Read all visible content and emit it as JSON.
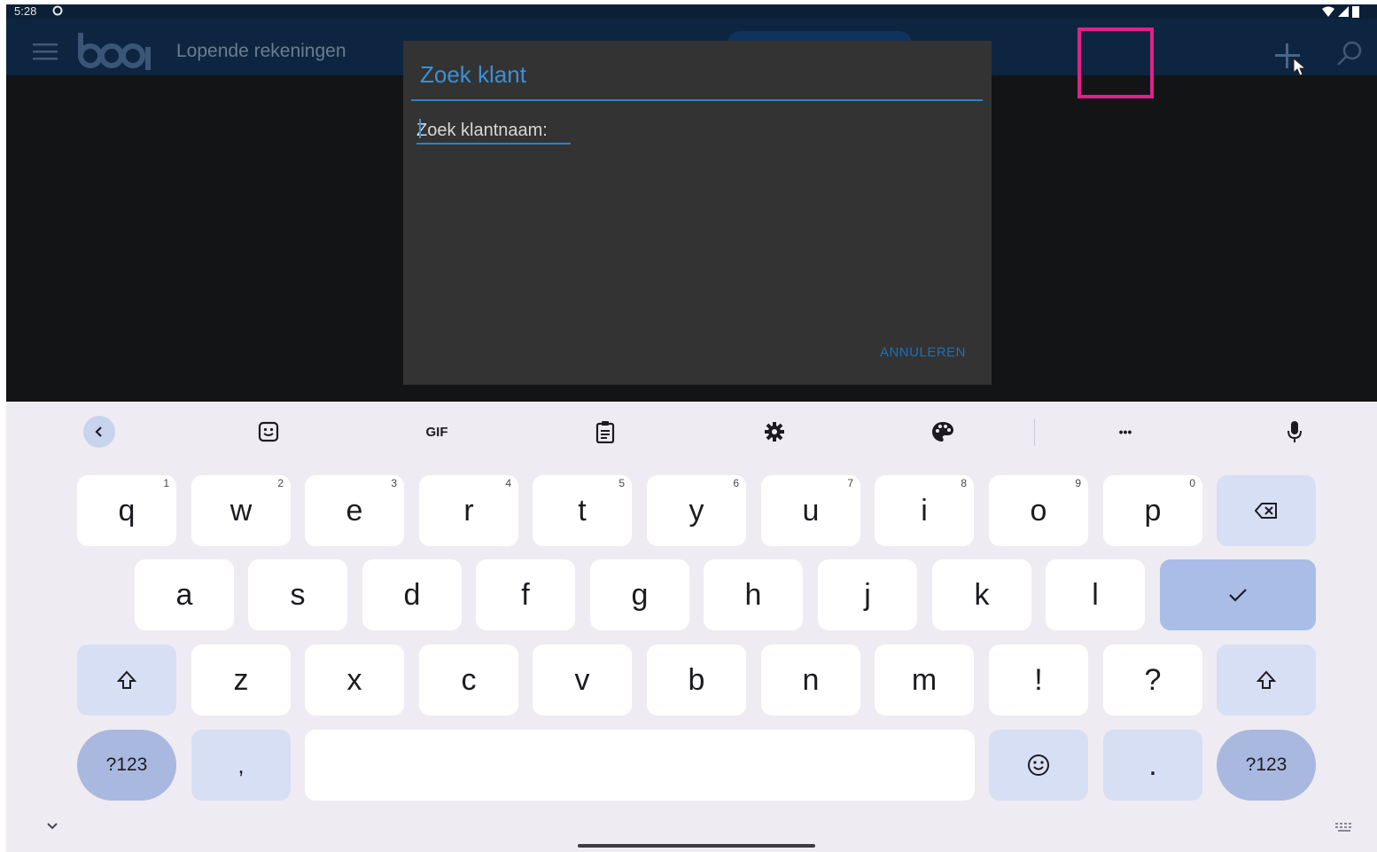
{
  "status_bar": {
    "time": "5:28"
  },
  "app_bar": {
    "brand": "booq",
    "title": "Lopende rekeningen"
  },
  "dialog": {
    "title": "Zoek klant",
    "search_label": "Zoek klantnaam:",
    "cancel_label": "ANNULEREN"
  },
  "keyboard": {
    "toolbar": {
      "gif_label": "GIF",
      "more_label": "•••"
    },
    "row1": [
      {
        "label": "q",
        "hint": "1"
      },
      {
        "label": "w",
        "hint": "2"
      },
      {
        "label": "e",
        "hint": "3"
      },
      {
        "label": "r",
        "hint": "4"
      },
      {
        "label": "t",
        "hint": "5"
      },
      {
        "label": "y",
        "hint": "6"
      },
      {
        "label": "u",
        "hint": "7"
      },
      {
        "label": "i",
        "hint": "8"
      },
      {
        "label": "o",
        "hint": "9"
      },
      {
        "label": "p",
        "hint": "0"
      }
    ],
    "row2": [
      "a",
      "s",
      "d",
      "f",
      "g",
      "h",
      "j",
      "k",
      "l"
    ],
    "row3": [
      "z",
      "x",
      "c",
      "v",
      "b",
      "n",
      "m",
      "!",
      "?"
    ],
    "symbols_label": "?123",
    "comma_label": ",",
    "period_label": "."
  },
  "colors": {
    "accent": "#3d8fd6",
    "highlight": "#e0218a",
    "app_bar": "#0d2540"
  }
}
